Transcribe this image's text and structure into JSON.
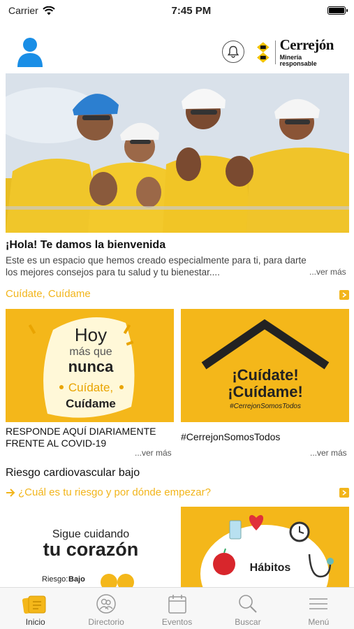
{
  "status_bar": {
    "carrier": "Carrier",
    "time": "7:45 PM"
  },
  "header": {
    "logo_name": "Cerrejón",
    "logo_tagline": "Minería responsable"
  },
  "welcome": {
    "title": "¡Hola! Te damos la bienvenida",
    "text": "Este es un espacio que hemos creado especialmente para ti, para darte los mejores consejos para tu salud y tu bienestar....",
    "more": "...ver más"
  },
  "section1": {
    "title": "Cuídate, Cuídame",
    "cards": [
      {
        "art_line1": "Hoy",
        "art_line2": "más que",
        "art_line3": "nunca",
        "art_line4": "Cuídate,",
        "art_line5": "Cuídame",
        "caption": "RESPONDE AQUÍ DIARIAMENTE FRENTE AL COVID-19",
        "more": "...ver más"
      },
      {
        "art_line1": "¡Cuídate!",
        "art_line2": "¡Cuídame!",
        "art_line3": "#CerrejonSomosTodos",
        "caption": "#CerrejonSomosTodos",
        "more": "...ver más"
      }
    ]
  },
  "section2": {
    "heading": "Riesgo cardiovascular bajo",
    "link": "¿Cuál es tu riesgo y por dónde empezar?",
    "cards": [
      {
        "line1": "Sigue cuidando",
        "line2": "tu corazón",
        "risk_label": "Riesgo:",
        "risk_value": "Bajo"
      },
      {
        "label": "Hábitos"
      }
    ]
  },
  "tabbar": {
    "tabs": [
      {
        "label": "Inicio"
      },
      {
        "label": "Directorio"
      },
      {
        "label": "Eventos"
      },
      {
        "label": "Buscar"
      },
      {
        "label": "Menú"
      }
    ]
  },
  "colors": {
    "accent": "#f2b51b",
    "user_blue": "#1a8ee6",
    "hero_yellow": "#f4c21f"
  }
}
